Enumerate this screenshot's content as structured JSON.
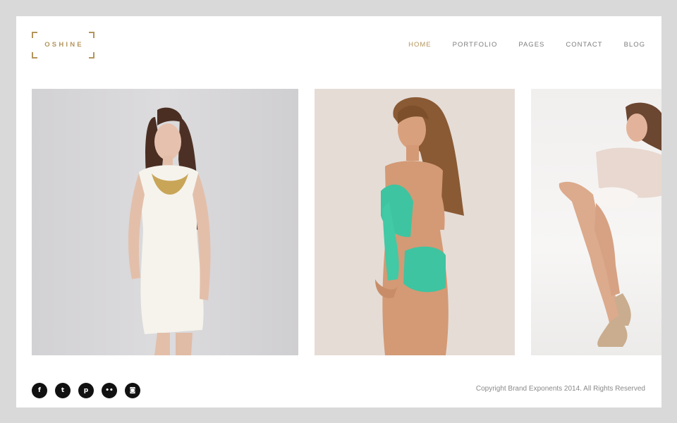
{
  "brand": {
    "name": "OSHINE",
    "color": "#b4955d"
  },
  "nav": {
    "items": [
      {
        "label": "HOME",
        "active": true
      },
      {
        "label": "PORTFOLIO",
        "active": false
      },
      {
        "label": "PAGES",
        "active": false
      },
      {
        "label": "CONTACT",
        "active": false
      },
      {
        "label": "BLOG",
        "active": false
      }
    ]
  },
  "gallery": {
    "photos": [
      {
        "subject": "model-white-dress"
      },
      {
        "subject": "model-green-swimsuit"
      },
      {
        "subject": "model-sweater-heels"
      }
    ]
  },
  "footer": {
    "social": [
      {
        "icon": "facebook-icon",
        "glyph": "f"
      },
      {
        "icon": "twitter-icon",
        "glyph": "t"
      },
      {
        "icon": "pinterest-icon",
        "glyph": "p"
      },
      {
        "icon": "flickr-icon",
        "glyph": "••"
      },
      {
        "icon": "instagram-icon",
        "glyph": "◙"
      }
    ],
    "copyright": "Copyright Brand Exponents 2014. All Rights Reserved"
  }
}
